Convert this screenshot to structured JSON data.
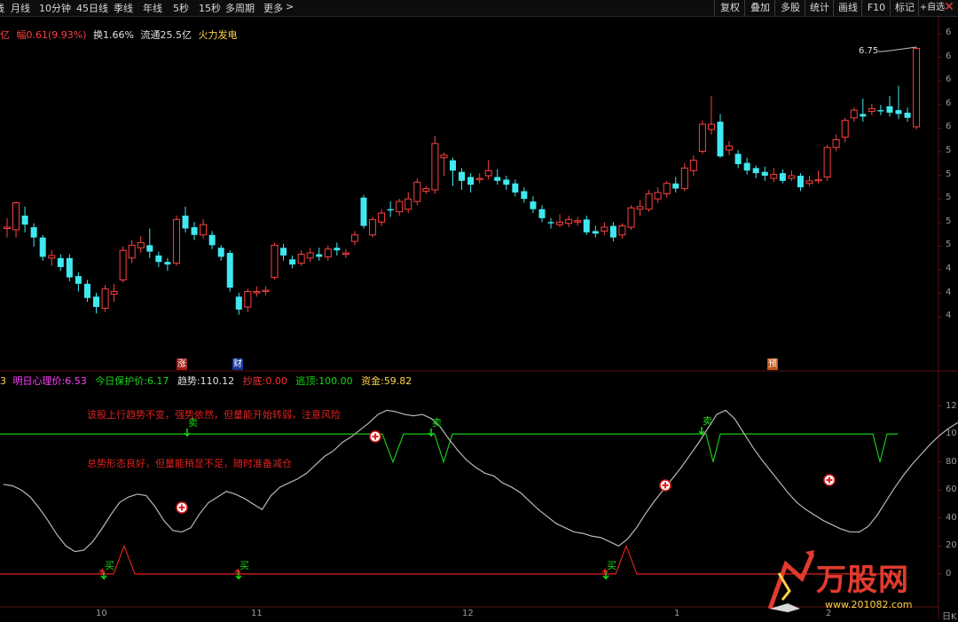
{
  "toolbar": {
    "periods": [
      "线",
      "月线",
      "10分钟",
      "45日线",
      "季线",
      "年线",
      "5秒",
      "15秒",
      "多周期",
      "更多"
    ],
    "more_arrow": ">",
    "buttons": [
      "复权",
      "叠加",
      "多股",
      "统计",
      "画线",
      "F10",
      "标记",
      "+自选"
    ],
    "buttons_extra": "",
    "close": "✕"
  },
  "quote_line": {
    "unit": "亿",
    "change_label": "幅",
    "change_value": "0.61(9.93%)",
    "turnover": "换1.66%",
    "float_cap": "流通25.5亿",
    "sector": "火力发电"
  },
  "price_axis": {
    "ticks": [
      "6",
      "6",
      "6",
      "6",
      "6",
      "5",
      "5",
      "5",
      "5",
      "5",
      "4",
      "4",
      "4"
    ],
    "last_price_label": "6.75"
  },
  "indicator_line": {
    "prefix": "3",
    "xlsj_label": "明日心理价:",
    "xlsj_value": "6.53",
    "protect_label": "今日保护价:",
    "protect_value": "6.17",
    "trend_label": "趋势:",
    "trend_value": "110.12",
    "bottom_label": "抄底:",
    "bottom_value": "0.00",
    "top_label": "逃顶:",
    "top_value": "100.00",
    "fund_label": "资金:",
    "fund_value": "59.82"
  },
  "lower_axis": {
    "ticks": [
      "12",
      "10",
      "80",
      "60",
      "40",
      "20",
      "0"
    ]
  },
  "notes": {
    "note1": "该股上行趋势不变，强势依然，但量能开始转弱，注意风险",
    "note2": "总势形态良好，但量能稍显不足，随时准备减仓"
  },
  "signals": {
    "buy": "买",
    "sell": "卖"
  },
  "markers": {
    "limit_up": "涨",
    "finance": "财",
    "forecast": "预"
  },
  "dates": [
    "10",
    "11",
    "12",
    "1",
    "2"
  ],
  "date_axis_tail": "日K",
  "watermark": {
    "brand": "万股网",
    "url": "www.201082.com"
  },
  "colors": {
    "up": "#ff4040",
    "down": "#40e8f0",
    "green": "#18c818",
    "text_magenta": "#ff40ff",
    "accent_yellow": "#ffd24a"
  },
  "chart_data": {
    "type": "candlestick",
    "candles": [
      {
        "o": 5.35,
        "c": 5.36,
        "h": 5.43,
        "l": 5.28
      },
      {
        "o": 5.34,
        "c": 5.55,
        "h": 5.56,
        "l": 5.28
      },
      {
        "o": 5.45,
        "c": 5.38,
        "h": 5.52,
        "l": 5.32
      },
      {
        "o": 5.36,
        "c": 5.28,
        "h": 5.39,
        "l": 5.21
      },
      {
        "o": 5.28,
        "c": 5.13,
        "h": 5.3,
        "l": 5.1
      },
      {
        "o": 5.12,
        "c": 5.14,
        "h": 5.18,
        "l": 5.06
      },
      {
        "o": 5.12,
        "c": 5.05,
        "h": 5.15,
        "l": 5.02
      },
      {
        "o": 5.12,
        "c": 4.97,
        "h": 5.15,
        "l": 4.94
      },
      {
        "o": 4.98,
        "c": 4.92,
        "h": 5.01,
        "l": 4.86
      },
      {
        "o": 4.92,
        "c": 4.81,
        "h": 4.95,
        "l": 4.78
      },
      {
        "o": 4.82,
        "c": 4.74,
        "h": 4.85,
        "l": 4.69
      },
      {
        "o": 4.73,
        "c": 4.88,
        "h": 4.91,
        "l": 4.7
      },
      {
        "o": 4.84,
        "c": 4.86,
        "h": 4.92,
        "l": 4.78
      },
      {
        "o": 4.95,
        "c": 5.18,
        "h": 5.21,
        "l": 4.93
      },
      {
        "o": 5.12,
        "c": 5.22,
        "h": 5.26,
        "l": 5.08
      },
      {
        "o": 5.2,
        "c": 5.24,
        "h": 5.29,
        "l": 5.16
      },
      {
        "o": 5.22,
        "c": 5.17,
        "h": 5.35,
        "l": 5.12
      },
      {
        "o": 5.14,
        "c": 5.09,
        "h": 5.17,
        "l": 5.05
      },
      {
        "o": 5.09,
        "c": 5.07,
        "h": 5.12,
        "l": 5.02
      },
      {
        "o": 5.08,
        "c": 5.42,
        "h": 5.45,
        "l": 5.06
      },
      {
        "o": 5.45,
        "c": 5.35,
        "h": 5.52,
        "l": 5.32
      },
      {
        "o": 5.36,
        "c": 5.3,
        "h": 5.4,
        "l": 5.26
      },
      {
        "o": 5.3,
        "c": 5.38,
        "h": 5.42,
        "l": 5.27
      },
      {
        "o": 5.3,
        "c": 5.22,
        "h": 5.33,
        "l": 5.19
      },
      {
        "o": 5.2,
        "c": 5.13,
        "h": 5.22,
        "l": 5.1
      },
      {
        "o": 5.16,
        "c": 4.89,
        "h": 5.18,
        "l": 4.86
      },
      {
        "o": 4.82,
        "c": 4.72,
        "h": 4.85,
        "l": 4.68
      },
      {
        "o": 4.74,
        "c": 4.86,
        "h": 4.88,
        "l": 4.7
      },
      {
        "o": 4.85,
        "c": 4.86,
        "h": 4.9,
        "l": 4.82
      },
      {
        "o": 4.86,
        "c": 4.87,
        "h": 4.9,
        "l": 4.83
      },
      {
        "o": 4.97,
        "c": 5.22,
        "h": 5.24,
        "l": 4.95
      },
      {
        "o": 5.2,
        "c": 5.14,
        "h": 5.23,
        "l": 5.1
      },
      {
        "o": 5.11,
        "c": 5.07,
        "h": 5.14,
        "l": 5.04
      },
      {
        "o": 5.08,
        "c": 5.15,
        "h": 5.18,
        "l": 5.06
      },
      {
        "o": 5.12,
        "c": 5.16,
        "h": 5.2,
        "l": 5.09
      },
      {
        "o": 5.15,
        "c": 5.13,
        "h": 5.2,
        "l": 5.1
      },
      {
        "o": 5.13,
        "c": 5.19,
        "h": 5.22,
        "l": 5.1
      },
      {
        "o": 5.2,
        "c": 5.18,
        "h": 5.24,
        "l": 5.14
      },
      {
        "o": 5.15,
        "c": 5.16,
        "h": 5.19,
        "l": 5.12
      },
      {
        "o": 5.25,
        "c": 5.3,
        "h": 5.33,
        "l": 5.22
      },
      {
        "o": 5.59,
        "c": 5.37,
        "h": 5.61,
        "l": 5.35
      },
      {
        "o": 5.3,
        "c": 5.42,
        "h": 5.44,
        "l": 5.28
      },
      {
        "o": 5.4,
        "c": 5.47,
        "h": 5.5,
        "l": 5.37
      },
      {
        "o": 5.5,
        "c": 5.49,
        "h": 5.56,
        "l": 5.44
      },
      {
        "o": 5.48,
        "c": 5.56,
        "h": 5.58,
        "l": 5.45
      },
      {
        "o": 5.5,
        "c": 5.58,
        "h": 5.63,
        "l": 5.47
      },
      {
        "o": 5.56,
        "c": 5.71,
        "h": 5.74,
        "l": 5.53
      },
      {
        "o": 5.64,
        "c": 5.66,
        "h": 5.68,
        "l": 5.62
      },
      {
        "o": 5.65,
        "c": 6.01,
        "h": 6.07,
        "l": 5.62
      },
      {
        "o": 5.9,
        "c": 5.92,
        "h": 5.94,
        "l": 5.76
      },
      {
        "o": 5.88,
        "c": 5.8,
        "h": 5.9,
        "l": 5.68
      },
      {
        "o": 5.79,
        "c": 5.72,
        "h": 5.82,
        "l": 5.65
      },
      {
        "o": 5.75,
        "c": 5.69,
        "h": 5.78,
        "l": 5.63
      },
      {
        "o": 5.73,
        "c": 5.74,
        "h": 5.78,
        "l": 5.7
      },
      {
        "o": 5.76,
        "c": 5.8,
        "h": 5.88,
        "l": 5.73
      },
      {
        "o": 5.75,
        "c": 5.72,
        "h": 5.81,
        "l": 5.69
      },
      {
        "o": 5.73,
        "c": 5.69,
        "h": 5.76,
        "l": 5.65
      },
      {
        "o": 5.7,
        "c": 5.63,
        "h": 5.73,
        "l": 5.6
      },
      {
        "o": 5.64,
        "c": 5.58,
        "h": 5.67,
        "l": 5.55
      },
      {
        "o": 5.56,
        "c": 5.5,
        "h": 5.6,
        "l": 5.47
      },
      {
        "o": 5.5,
        "c": 5.43,
        "h": 5.53,
        "l": 5.4
      },
      {
        "o": 5.4,
        "c": 5.39,
        "h": 5.43,
        "l": 5.35
      },
      {
        "o": 5.38,
        "c": 5.4,
        "h": 5.46,
        "l": 5.36
      },
      {
        "o": 5.39,
        "c": 5.42,
        "h": 5.45,
        "l": 5.36
      },
      {
        "o": 5.4,
        "c": 5.41,
        "h": 5.44,
        "l": 5.37
      },
      {
        "o": 5.42,
        "c": 5.32,
        "h": 5.45,
        "l": 5.3
      },
      {
        "o": 5.33,
        "c": 5.31,
        "h": 5.37,
        "l": 5.28
      },
      {
        "o": 5.33,
        "c": 5.36,
        "h": 5.4,
        "l": 5.3
      },
      {
        "o": 5.37,
        "c": 5.28,
        "h": 5.4,
        "l": 5.25
      },
      {
        "o": 5.3,
        "c": 5.37,
        "h": 5.39,
        "l": 5.27
      },
      {
        "o": 5.36,
        "c": 5.51,
        "h": 5.53,
        "l": 5.34
      },
      {
        "o": 5.5,
        "c": 5.52,
        "h": 5.57,
        "l": 5.45
      },
      {
        "o": 5.5,
        "c": 5.62,
        "h": 5.65,
        "l": 5.48
      },
      {
        "o": 5.58,
        "c": 5.63,
        "h": 5.67,
        "l": 5.55
      },
      {
        "o": 5.62,
        "c": 5.7,
        "h": 5.72,
        "l": 5.59
      },
      {
        "o": 5.7,
        "c": 5.66,
        "h": 5.75,
        "l": 5.63
      },
      {
        "o": 5.66,
        "c": 5.82,
        "h": 5.86,
        "l": 5.64
      },
      {
        "o": 5.8,
        "c": 5.88,
        "h": 5.92,
        "l": 5.76
      },
      {
        "o": 5.95,
        "c": 6.16,
        "h": 6.19,
        "l": 5.93
      },
      {
        "o": 6.12,
        "c": 6.16,
        "h": 6.38,
        "l": 6.08
      },
      {
        "o": 6.18,
        "c": 5.91,
        "h": 6.24,
        "l": 5.9
      },
      {
        "o": 5.96,
        "c": 5.99,
        "h": 6.03,
        "l": 5.92
      },
      {
        "o": 5.93,
        "c": 5.85,
        "h": 5.96,
        "l": 5.82
      },
      {
        "o": 5.86,
        "c": 5.8,
        "h": 5.9,
        "l": 5.77
      },
      {
        "o": 5.82,
        "c": 5.78,
        "h": 5.84,
        "l": 5.74
      },
      {
        "o": 5.79,
        "c": 5.76,
        "h": 5.83,
        "l": 5.72
      },
      {
        "o": 5.74,
        "c": 5.77,
        "h": 5.82,
        "l": 5.71
      },
      {
        "o": 5.78,
        "c": 5.72,
        "h": 5.81,
        "l": 5.7
      },
      {
        "o": 5.74,
        "c": 5.76,
        "h": 5.8,
        "l": 5.72
      },
      {
        "o": 5.76,
        "c": 5.67,
        "h": 5.78,
        "l": 5.64
      },
      {
        "o": 5.7,
        "c": 5.72,
        "h": 5.76,
        "l": 5.68
      },
      {
        "o": 5.72,
        "c": 5.73,
        "h": 5.8,
        "l": 5.7
      },
      {
        "o": 5.75,
        "c": 5.98,
        "h": 6.0,
        "l": 5.72
      },
      {
        "o": 5.98,
        "c": 6.04,
        "h": 6.08,
        "l": 5.95
      },
      {
        "o": 6.06,
        "c": 6.19,
        "h": 6.21,
        "l": 6.02
      },
      {
        "o": 6.21,
        "c": 6.27,
        "h": 6.29,
        "l": 6.18
      },
      {
        "o": 6.24,
        "c": 6.22,
        "h": 6.36,
        "l": 6.18
      },
      {
        "o": 6.26,
        "c": 6.28,
        "h": 6.32,
        "l": 6.23
      },
      {
        "o": 6.27,
        "c": 6.26,
        "h": 6.31,
        "l": 6.23
      },
      {
        "o": 6.3,
        "c": 6.25,
        "h": 6.38,
        "l": 6.22
      },
      {
        "o": 6.27,
        "c": 6.24,
        "h": 6.46,
        "l": 6.2
      },
      {
        "o": 6.25,
        "c": 6.21,
        "h": 6.29,
        "l": 6.18
      },
      {
        "o": 6.14,
        "c": 6.75,
        "h": 6.76,
        "l": 6.12
      }
    ],
    "price_range": [
      4.45,
      6.85
    ],
    "indicator": {
      "trend": [
        64,
        63,
        60,
        55,
        47,
        38,
        28,
        20,
        16,
        17,
        23,
        32,
        42,
        51,
        55,
        57,
        56,
        48,
        38,
        31,
        30,
        33,
        43,
        51,
        55,
        59,
        57,
        54,
        50,
        46,
        56,
        62,
        65,
        68,
        72,
        78,
        84,
        88,
        94,
        98,
        103,
        108,
        114,
        117,
        116,
        114,
        113,
        114,
        111,
        105,
        96,
        88,
        81,
        76,
        72,
        70,
        65,
        62,
        58,
        52,
        46,
        41,
        36,
        33,
        30,
        29,
        27,
        26,
        23,
        20,
        25,
        33,
        43,
        52,
        60,
        68,
        76,
        85,
        94,
        104,
        114,
        117,
        111,
        101,
        91,
        82,
        74,
        66,
        58,
        51,
        46,
        42,
        38,
        35,
        32,
        30,
        30,
        34,
        42,
        52,
        62,
        71,
        79,
        86,
        93,
        99,
        104,
        108,
        110
      ],
      "bottom_line": [
        20
      ],
      "top_line": [
        100
      ],
      "axis_range": [
        -2,
        128
      ]
    }
  }
}
